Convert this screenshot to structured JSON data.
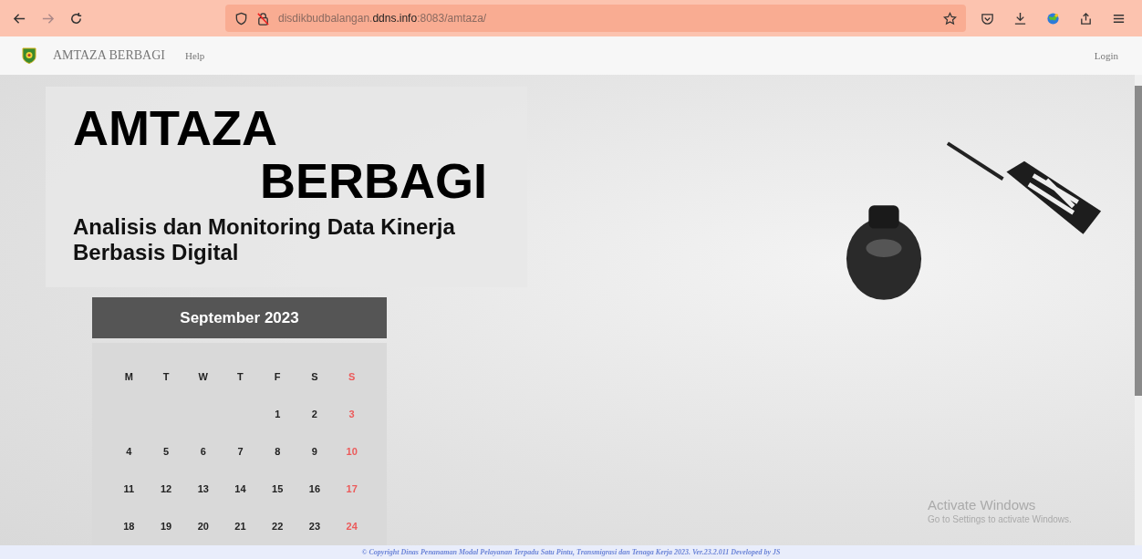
{
  "browser": {
    "address": {
      "subdomain": "disdikbudbalangan.",
      "domain": "ddns.info",
      "path": ":8083/amtaza/"
    },
    "forward_disabled": true
  },
  "navbar": {
    "brand": "AMTAZA BERBAGI",
    "links": [
      "Help"
    ],
    "login": "Login"
  },
  "hero": {
    "title_line1": "AMTAZA",
    "title_line2": "BERBAGI",
    "subtitle": "Analisis dan Monitoring Data Kinerja Berbasis Digital"
  },
  "calendar": {
    "month": "September 2023",
    "weekdays": [
      {
        "text": "M",
        "sunday": false
      },
      {
        "text": "T",
        "sunday": false
      },
      {
        "text": "W",
        "sunday": false
      },
      {
        "text": "T",
        "sunday": false
      },
      {
        "text": "F",
        "sunday": false
      },
      {
        "text": "S",
        "sunday": false
      },
      {
        "text": "S",
        "sunday": true
      }
    ],
    "weeks": [
      [
        {
          "text": "1",
          "sunday": false
        },
        {
          "text": "2",
          "sunday": false
        },
        {
          "text": "3",
          "sunday": true
        }
      ],
      [
        {
          "text": "4",
          "sunday": false
        },
        {
          "text": "5",
          "sunday": false
        },
        {
          "text": "6",
          "sunday": false
        },
        {
          "text": "7",
          "sunday": false
        },
        {
          "text": "8",
          "sunday": false
        },
        {
          "text": "9",
          "sunday": false
        },
        {
          "text": "10",
          "sunday": true
        }
      ],
      [
        {
          "text": "11",
          "sunday": false
        },
        {
          "text": "12",
          "sunday": false
        },
        {
          "text": "13",
          "sunday": false
        },
        {
          "text": "14",
          "sunday": false
        },
        {
          "text": "15",
          "sunday": false
        },
        {
          "text": "16",
          "sunday": false
        },
        {
          "text": "17",
          "sunday": true
        }
      ],
      [
        {
          "text": "18",
          "sunday": false
        },
        {
          "text": "19",
          "sunday": false
        },
        {
          "text": "20",
          "sunday": false
        },
        {
          "text": "21",
          "sunday": false
        },
        {
          "text": "22",
          "sunday": false
        },
        {
          "text": "23",
          "sunday": false
        },
        {
          "text": "24",
          "sunday": true
        }
      ]
    ]
  },
  "os_notice": {
    "title": "Activate Windows",
    "text": "Go to Settings to activate Windows."
  },
  "footer": "© Copyright Dinas Penanaman Modal Pelayanan Terpadu Satu Pintu, Transmigrasi dan Tenaga Kerja 2023. Ver.23.2.011 Developed by JS"
}
